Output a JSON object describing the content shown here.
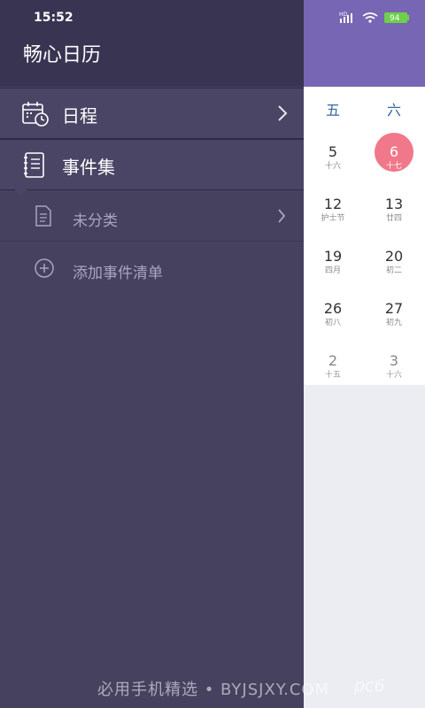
{
  "status_bar": {
    "time": "15:52",
    "battery": "94",
    "network": "HD"
  },
  "drawer": {
    "title": "畅心日历",
    "items": [
      {
        "label": "日程",
        "icon": "calendar-clock-icon"
      },
      {
        "label": "事件集",
        "icon": "notebook-icon"
      }
    ],
    "subitems": [
      {
        "label": "未分类",
        "icon": "document-icon"
      },
      {
        "label": "添加事件清单",
        "icon": "add-circle-icon"
      }
    ]
  },
  "calendar": {
    "weekdays": [
      "五",
      "六"
    ],
    "days": [
      {
        "num": "5",
        "sub": "十六"
      },
      {
        "num": "6",
        "sub": "十七",
        "today": true
      },
      {
        "num": "12",
        "sub": "护士节"
      },
      {
        "num": "13",
        "sub": "廿四"
      },
      {
        "num": "19",
        "sub": "四月"
      },
      {
        "num": "20",
        "sub": "初二"
      },
      {
        "num": "26",
        "sub": "初八"
      },
      {
        "num": "27",
        "sub": "初九"
      },
      {
        "num": "2",
        "sub": "十五",
        "muted": true
      },
      {
        "num": "3",
        "sub": "十六",
        "muted": true
      }
    ]
  },
  "watermark": {
    "text": "必用手机精选 • BYJSJXY.COM",
    "logo": "pc6"
  },
  "colors": {
    "drawer_bg": "#46415f",
    "header_purple": "#7766b3",
    "today": "#f0788a",
    "weekday": "#3a6aa0"
  }
}
